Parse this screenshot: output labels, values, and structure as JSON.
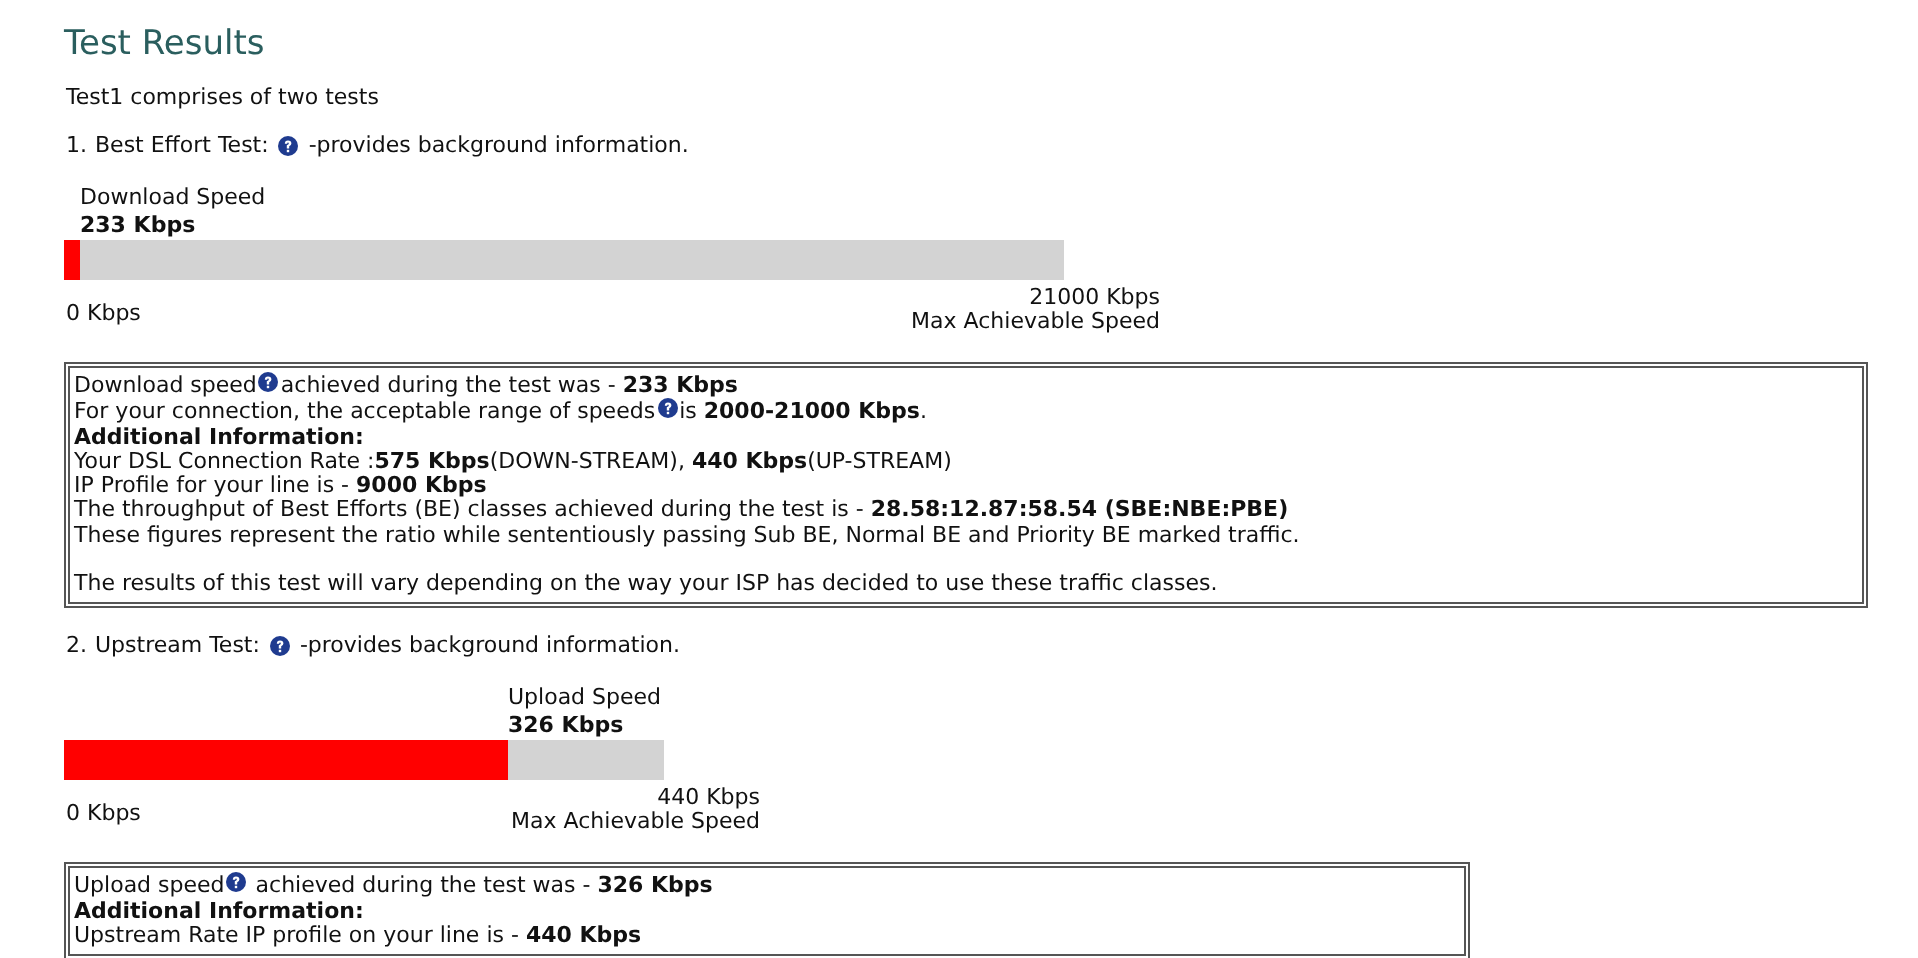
{
  "title": "Test Results",
  "intro": "Test1 comprises of two tests",
  "tests": [
    {
      "number": "1.",
      "name": "Best Effort Test:",
      "help_text": "-provides background information.",
      "meter": {
        "label": "Download Speed",
        "value": "233 Kbps",
        "level": 0.016,
        "min_label": "0 Kbps",
        "max_label": "21000 Kbps",
        "max_caption": "Max Achievable Speed"
      },
      "info": [
        {
          "kind": "with_help",
          "before": "Download speed",
          "text": "achieved during the test was - **233 Kbps**"
        },
        {
          "kind": "with_help",
          "before": "For your connection, the acceptable range of speeds",
          "text": "is **2000-21000 Kbps**."
        },
        {
          "kind": "heading",
          "text": "Additional Information:"
        },
        {
          "kind": "plain",
          "text": "Your DSL Connection Rate :**575 Kbps**(DOWN-STREAM), **440 Kbps**(UP-STREAM)"
        },
        {
          "kind": "plain",
          "text": "IP Profile for your line is - **9000 Kbps**"
        },
        {
          "kind": "plain",
          "text": "The throughput of Best Efforts (BE) classes achieved during the test is - **28.58:12.87:58.54 (SBE:NBE:PBE)**"
        },
        {
          "kind": "plain",
          "text": "These figures represent the ratio while sententiously passing Sub BE, Normal BE and Priority BE marked traffic."
        },
        {
          "kind": "new_paragraph",
          "text": "The results of this test will vary depending on the way your ISP has decided to use these traffic classes."
        }
      ]
    },
    {
      "number": "2.",
      "name": "Upstream Test:",
      "help_text": "-provides background information.",
      "meter": {
        "label": "Upload Speed",
        "value": "326 Kbps",
        "level": 0.74,
        "min_label": "0 Kbps",
        "max_label": "440 Kbps",
        "max_caption": "Max Achievable Speed"
      },
      "info": [
        {
          "kind": "with_help",
          "before": "Upload speed",
          "text": " achieved during the test was - **326 Kbps**"
        },
        {
          "kind": "heading",
          "text": "Additional Information:"
        },
        {
          "kind": "plain",
          "text": "Upstream Rate IP profile on your line is - **440 Kbps**"
        }
      ]
    }
  ]
}
